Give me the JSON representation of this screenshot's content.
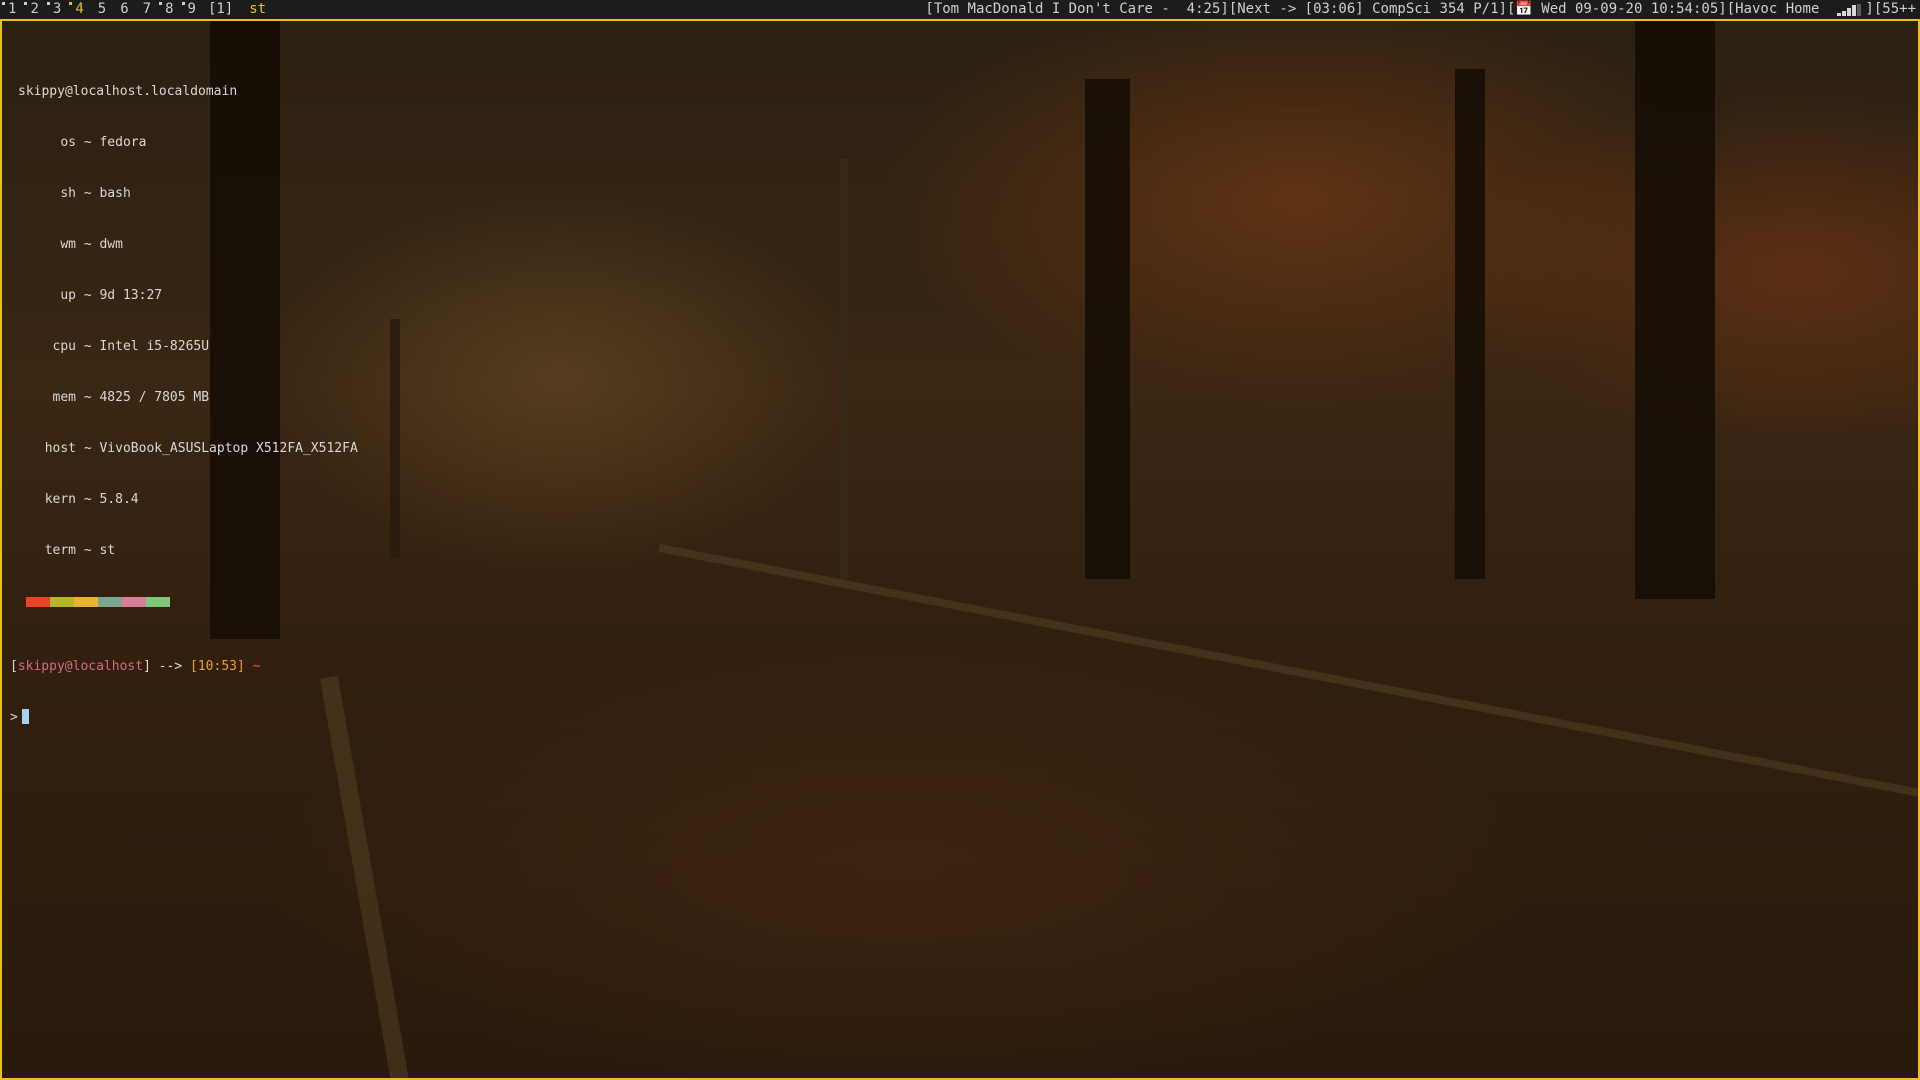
{
  "bar": {
    "tags": [
      {
        "label": "1",
        "occupied": true,
        "selected": false
      },
      {
        "label": "2",
        "occupied": true,
        "selected": false
      },
      {
        "label": "3",
        "occupied": true,
        "selected": false
      },
      {
        "label": "4",
        "occupied": true,
        "selected": true
      },
      {
        "label": "5",
        "occupied": false,
        "selected": false
      },
      {
        "label": "6",
        "occupied": false,
        "selected": false
      },
      {
        "label": "7",
        "occupied": false,
        "selected": false
      },
      {
        "label": "8",
        "occupied": true,
        "selected": false
      },
      {
        "label": "9",
        "occupied": true,
        "selected": false
      }
    ],
    "layout_symbol": "[1]",
    "window_title": "st",
    "status_text": "[Tom MacDonald I Don't Care -  4:25][Next -> [03:06] CompSci 354 P/1][📅 Wed 09-09-20 10:54:05][Havoc Home",
    "wifi_icon": "signal-strength-icon",
    "battery_text": "][55++"
  },
  "colors": {
    "bar_bg": "#1c1c1c",
    "accent": "#e8c21a",
    "user": "#d16a8a",
    "time": "#e8a030",
    "dir": "#e05a3a",
    "cursor": "#a8d0f0"
  },
  "terminal": {
    "hostname_line": "skippy@localhost.localdomain",
    "info": [
      {
        "key": "os",
        "value": "fedora"
      },
      {
        "key": "sh",
        "value": "bash"
      },
      {
        "key": "wm",
        "value": "dwm"
      },
      {
        "key": "up",
        "value": "9d 13:27"
      },
      {
        "key": "cpu",
        "value": "Intel i5-8265U"
      },
      {
        "key": "mem",
        "value": "4825 / 7805 MB"
      },
      {
        "key": "host",
        "value": "VivoBook_ASUSLaptop X512FA_X512FA"
      },
      {
        "key": "kern",
        "value": "5.8.4"
      },
      {
        "key": "term",
        "value": "st"
      }
    ],
    "separator": "~",
    "palette": [
      "#e8442a",
      "#b6b62a",
      "#e8b430",
      "#7aa58e",
      "#d67e9a",
      "#7ec87a"
    ],
    "prompt": {
      "open": "[",
      "user": "skippy@localhost",
      "close": "]",
      "arrow": " --> ",
      "time": "[10:53]",
      "dir": "~",
      "symbol": ">"
    }
  }
}
